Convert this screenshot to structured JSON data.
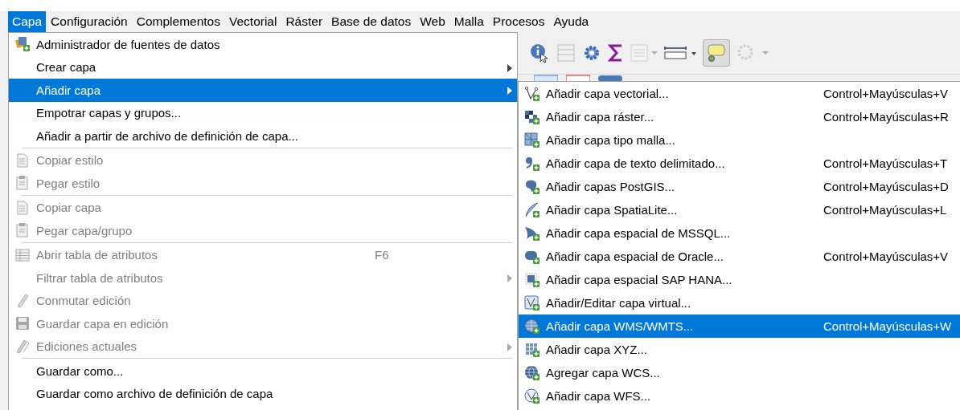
{
  "menubar": [
    {
      "label": "Capa",
      "selected": true
    },
    {
      "label": "Configuración",
      "selected": false
    },
    {
      "label": "Complementos",
      "selected": false
    },
    {
      "label": "Vectorial",
      "selected": false
    },
    {
      "label": "Ráster",
      "selected": false
    },
    {
      "label": "Base de datos",
      "selected": false
    },
    {
      "label": "Web",
      "selected": false
    },
    {
      "label": "Malla",
      "selected": false
    },
    {
      "label": "Procesos",
      "selected": false
    },
    {
      "label": "Ayuda",
      "selected": false
    }
  ],
  "layer_menu": [
    {
      "kind": "item",
      "label": "Administrador de fuentes de datos",
      "selected": false,
      "disabled": false,
      "submenu": false
    },
    {
      "kind": "item",
      "label": "Crear capa",
      "selected": false,
      "disabled": false,
      "submenu": true
    },
    {
      "kind": "item",
      "label": "Añadir capa",
      "selected": true,
      "disabled": false,
      "submenu": true
    },
    {
      "kind": "item",
      "label": "Empotrar capas y grupos...",
      "selected": false,
      "disabled": false,
      "submenu": false
    },
    {
      "kind": "item",
      "label": "Añadir a partir de archivo de definición de capa...",
      "selected": false,
      "disabled": false,
      "submenu": false
    },
    {
      "kind": "separator"
    },
    {
      "kind": "item",
      "label": "Copiar estilo",
      "selected": false,
      "disabled": true,
      "submenu": false
    },
    {
      "kind": "item",
      "label": "Pegar estilo",
      "selected": false,
      "disabled": true,
      "submenu": false
    },
    {
      "kind": "separator"
    },
    {
      "kind": "item",
      "label": "Copiar capa",
      "selected": false,
      "disabled": true,
      "submenu": false
    },
    {
      "kind": "item",
      "label": "Pegar capa/grupo",
      "selected": false,
      "disabled": true,
      "submenu": false
    },
    {
      "kind": "separator"
    },
    {
      "kind": "item",
      "label": "Abrir tabla de atributos",
      "shortcut": "F6",
      "selected": false,
      "disabled": true,
      "submenu": false
    },
    {
      "kind": "item",
      "label": "Filtrar tabla de atributos",
      "selected": false,
      "disabled": true,
      "submenu": true
    },
    {
      "kind": "item",
      "label": "Conmutar edición",
      "selected": false,
      "disabled": true,
      "submenu": false
    },
    {
      "kind": "item",
      "label": "Guardar capa en edición",
      "selected": false,
      "disabled": true,
      "submenu": false
    },
    {
      "kind": "item",
      "label": "Ediciones actuales",
      "selected": false,
      "disabled": true,
      "submenu": true
    },
    {
      "kind": "separator"
    },
    {
      "kind": "item",
      "label": "Guardar como...",
      "selected": false,
      "disabled": false,
      "submenu": false
    },
    {
      "kind": "item",
      "label": "Guardar como archivo de definición de capa",
      "selected": false,
      "disabled": false,
      "submenu": false
    }
  ],
  "add_layer_submenu": [
    {
      "label": "Añadir capa vectorial...",
      "shortcut": "Control+Mayúsculas+V",
      "selected": false
    },
    {
      "label": "Añadir capa ráster...",
      "shortcut": "Control+Mayúsculas+R",
      "selected": false
    },
    {
      "label": "Añadir capa tipo malla...",
      "selected": false
    },
    {
      "label": "Añadir capa de texto delimitado...",
      "shortcut": "Control+Mayúsculas+T",
      "selected": false
    },
    {
      "label": "Añadir capas PostGIS...",
      "shortcut": "Control+Mayúsculas+D",
      "selected": false
    },
    {
      "label": "Añadir capa SpatiaLite...",
      "shortcut": "Control+Mayúsculas+L",
      "selected": false
    },
    {
      "label": "Añadir capa espacial de MSSQL...",
      "selected": false
    },
    {
      "label": "Añadir capa espacial de Oracle...",
      "shortcut": "Control+Mayúsculas+V",
      "selected": false
    },
    {
      "label": "Añadir capa espacial SAP HANA...",
      "selected": false
    },
    {
      "label": "Añadir/Editar capa virtual...",
      "selected": false
    },
    {
      "label": "Añadir capa WMS/WMTS...",
      "shortcut": "Control+Mayúsculas+W",
      "selected": true
    },
    {
      "label": "Añadir capa XYZ...",
      "selected": false
    },
    {
      "label": "Agregar capa WCS...",
      "selected": false
    },
    {
      "label": "Añadir capa WFS...",
      "selected": false
    }
  ]
}
